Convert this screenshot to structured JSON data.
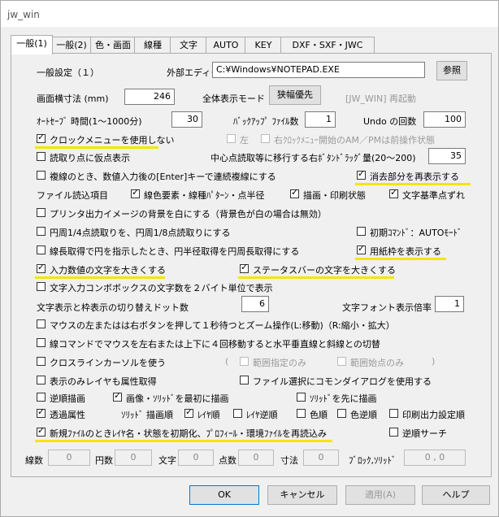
{
  "title": "jw_win",
  "tabs": [
    "一般(1)",
    "一般(2)",
    "色・画面",
    "線種",
    "文字",
    "AUTO",
    "KEY",
    "DXF・SXF・JWC"
  ],
  "section_title": "一般設定（１）",
  "editor_label": "外部エディタ",
  "editor_value": "C:¥Windows¥NOTEPAD.EXE",
  "browse_button": "参照",
  "screen_width_label": "画面横寸法 (mm)",
  "screen_width_value": "246",
  "fullscreen_mode_label": "全体表示モード",
  "fullscreen_mode_button": "狭幅優先",
  "restart_note": "[JW_WIN] 再起動",
  "autosave_label": "ｵｰﾄｾｰﾌﾞ 時間(1〜1000分)",
  "autosave_value": "30",
  "backup_label": "ﾊﾞｯｸｱｯﾌﾟ ﾌｧｲﾙ数",
  "backup_value": "1",
  "undo_label": "Undo の回数",
  "undo_value": "100",
  "clockmenu": "クロックメニューを使用しない",
  "left": "左",
  "clock_right_note": "右ｸﾛｯｸﾒﾆｭｰ開始のAM／PMは前操作状態",
  "readpoint": "読取り点に仮点表示",
  "center_drag_label": "中心点読取等に移行する右ﾎﾞﾀﾝﾄﾞﾗｯｸﾞ量(20〜200)",
  "center_drag_value": "35",
  "multi_copy": "複線のとき、数値入力後の[Enter]キーで連続複線にする",
  "redisplay_erased": "消去部分を再表示する",
  "file_read_label": "ファイル読込項目",
  "fr_color": "線色要素・線種ﾊﾟﾀｰﾝ・点半径",
  "fr_draw": "描画・印刷状態",
  "fr_text": "文字基準点ずれ",
  "printer_white": "プリンタ出力イメージの背景を白にする（背景色が白の場合は無効）",
  "circle_quarter": "円周1/4点読取りを、円周1/8点読取りにする",
  "initial_auto": "初期ｺﾏﾝﾄﾞ：AUTOﾓｰﾄﾞ",
  "radius_read": "線長取得で円を指示したとき、円半径取得を円周長取得にする",
  "show_paper_frame": "用紙枠を表示する",
  "input_large": "入力数値の文字を大きくする",
  "statusbar_large": "ステータスバーの文字を大きくする",
  "combobox_2byte": "文字入力コンボボックスの文字数を２バイト単位で表示",
  "text_frame_dots_label": "文字表示と枠表示の切り替えドット数",
  "text_frame_dots_value": "6",
  "text_font_scale_label": "文字フォント表示倍率",
  "text_font_scale_value": "1",
  "mouse_zoom": "マウスの左またはは右ボタンを押して１秒待つとズーム操作(L:移動)（R:縮小・拡大）",
  "line_cmd_mouse": "線コマンドでマウスを左右または上下に４回移動すると水平垂直線と斜線との切替",
  "crossline_cursor": "クロスラインカーソルを使う",
  "paren_open": "(",
  "range_only": "範囲指定のみ",
  "range_start_only": "範囲始点のみ",
  "paren_close": ")",
  "display_layer_only": "表示のみレイヤも属性取得",
  "common_dialog": "ファイル選択にコモンダイアログを使用する",
  "reverse_draw": "逆順描画",
  "image_solid_first": "画像・ｿﾘｯﾄﾞを最初に描画",
  "solid_first": "ｿﾘｯﾄﾞを先に描画",
  "transparency": "透過属性",
  "solid_draw_order": "ｿﾘｯﾄﾞ 描画順",
  "layer_order": "ﾚｲﾔ順",
  "layer_reverse": "ﾚｲﾔ逆順",
  "color_order": "色順",
  "color_reverse": "色逆順",
  "print_order": "印刷出力設定順",
  "new_file_init": "新規ﾌｧｲﾙのときﾚｲﾔ名・状態を初期化、ﾌﾟﾛﾌｨｰﾙ・環境ﾌｧｲﾙを再読込み",
  "reverse_search": "逆順サーチ",
  "status": {
    "lines_label": "線数",
    "lines_value": "0",
    "arcs_label": "円数",
    "arcs_value": "0",
    "texts_label": "文字",
    "texts_value": "0",
    "points_label": "点数",
    "points_value": "0",
    "dims_label": "寸法",
    "dims_value": "0",
    "blocks_label": "ﾌﾞﾛｯｸ,ｿﾘｯﾄﾞ",
    "blocks_value": "0 , 0"
  },
  "buttons": {
    "ok": "OK",
    "cancel": "キャンセル",
    "apply": "適用(A)",
    "help": "ヘルプ"
  }
}
